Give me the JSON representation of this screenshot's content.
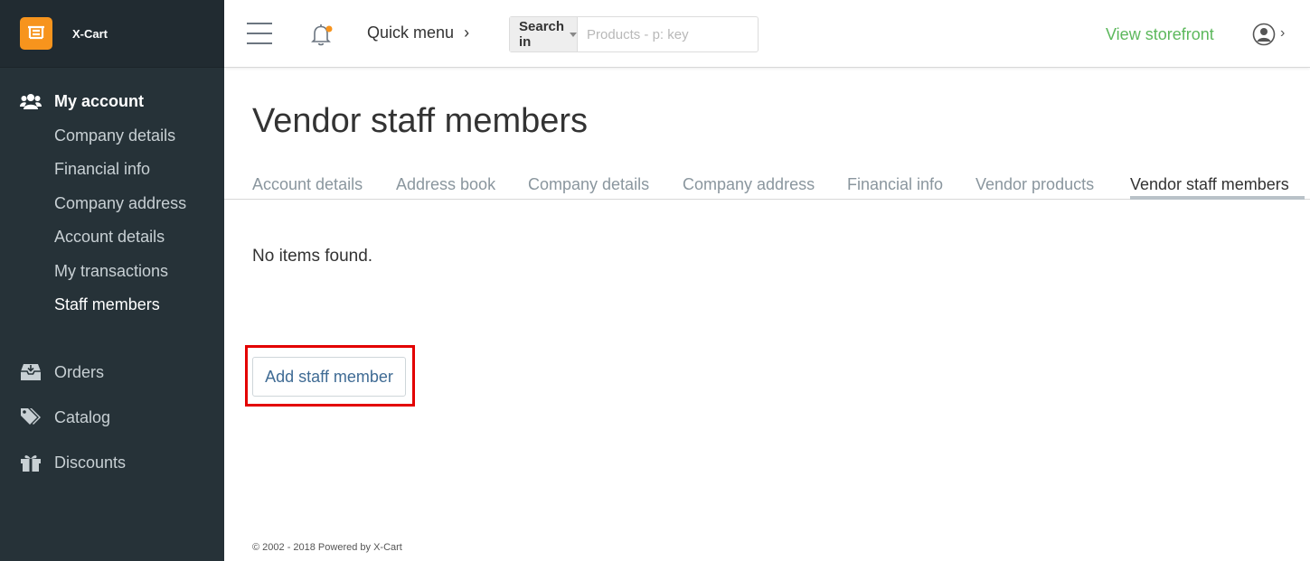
{
  "brand": {
    "name": "X-Cart",
    "logo_color": "#f7941d"
  },
  "sidebar": {
    "sections": [
      {
        "label": "My account",
        "icon": "users-icon",
        "items": [
          {
            "label": "Company details"
          },
          {
            "label": "Financial info"
          },
          {
            "label": "Company address"
          },
          {
            "label": "Account details"
          },
          {
            "label": "My transactions"
          },
          {
            "label": "Staff members",
            "current": true
          }
        ]
      },
      {
        "label": "Orders",
        "icon": "inbox-icon"
      },
      {
        "label": "Catalog",
        "icon": "tags-icon"
      },
      {
        "label": "Discounts",
        "icon": "gift-icon"
      }
    ]
  },
  "header": {
    "quick_menu": "Quick menu",
    "search_scope": "Search in",
    "search_placeholder": "Products - p: key",
    "search_value": "",
    "view_storefront": "View storefront",
    "storefront_color": "#5cb85c",
    "notification_dot_color": "#f7941d"
  },
  "page": {
    "title": "Vendor staff members",
    "tabs": [
      {
        "label": "Account details"
      },
      {
        "label": "Address book"
      },
      {
        "label": "Company details"
      },
      {
        "label": "Company address"
      },
      {
        "label": "Financial info"
      },
      {
        "label": "Vendor products"
      },
      {
        "label": "Vendor staff members",
        "active": true
      }
    ],
    "empty_message": "No items found.",
    "add_button": "Add staff member",
    "highlight_color": "#e30000"
  },
  "footer": {
    "text": "© 2002 - 2018 Powered by X-Cart"
  }
}
